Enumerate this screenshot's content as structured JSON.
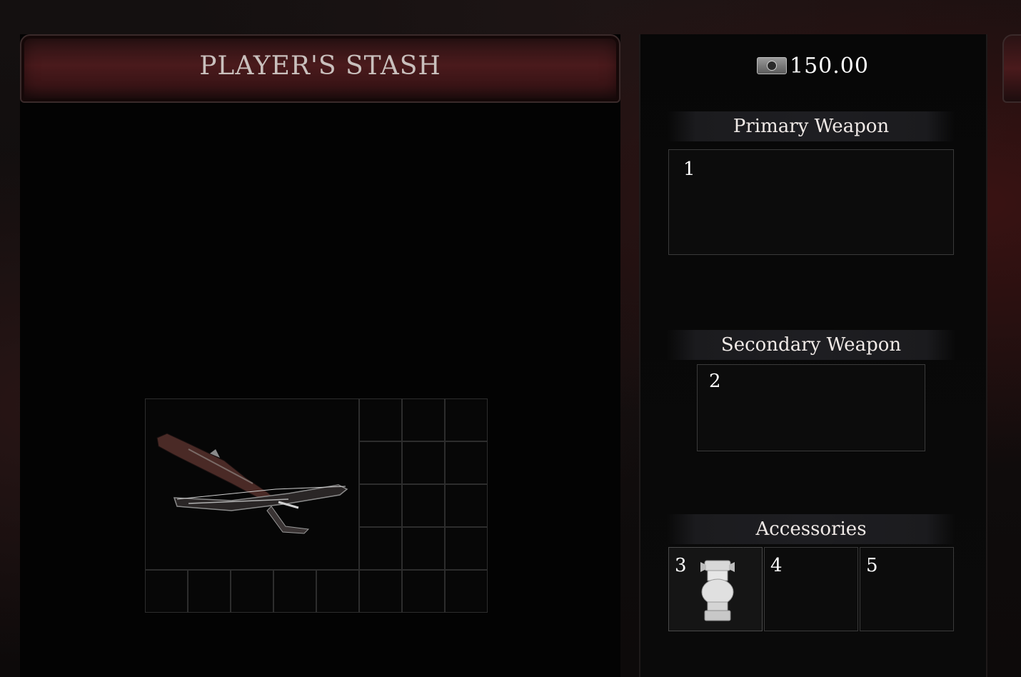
{
  "stash": {
    "title": "PLAYER'S STASH",
    "grid": {
      "columns": 8,
      "rows": 5
    },
    "items": [
      {
        "name": "crossbow",
        "icon": "crossbow-icon",
        "span": {
          "columns": 5,
          "rows": 4
        }
      }
    ]
  },
  "currency": {
    "icon": "coin-icon",
    "value": "150.00"
  },
  "equipment": {
    "primary": {
      "title": "Primary Weapon",
      "slot_number": "1"
    },
    "secondary": {
      "title": "Secondary Weapon",
      "slot_number": "2"
    },
    "accessories": {
      "title": "Accessories",
      "slots": [
        {
          "number": "3",
          "item_icon": "bandage-icon"
        },
        {
          "number": "4"
        },
        {
          "number": "5"
        }
      ]
    }
  },
  "colors": {
    "header_red": "#4a1a1c",
    "text_light": "#c9c0bd",
    "slot_border": "#3a3a3a"
  }
}
